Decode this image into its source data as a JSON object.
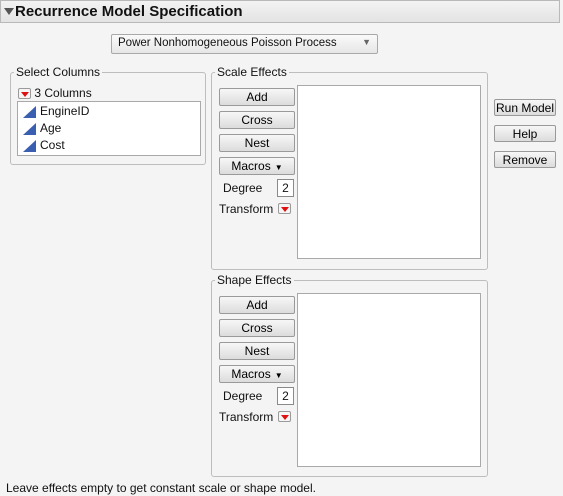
{
  "window": {
    "title": "Recurrence Model Specification"
  },
  "model_type": {
    "selected": "Power Nonhomogeneous Poisson Process"
  },
  "select_columns": {
    "legend": "Select Columns",
    "count_label": "3 Columns",
    "columns": [
      {
        "name": "EngineID",
        "icon": "continuous-column-icon"
      },
      {
        "name": "Age",
        "icon": "continuous-column-icon"
      },
      {
        "name": "Cost",
        "icon": "continuous-column-icon"
      }
    ]
  },
  "scale_effects": {
    "legend": "Scale Effects",
    "add": "Add",
    "cross": "Cross",
    "nest": "Nest",
    "macros": "Macros",
    "degree_label": "Degree",
    "degree_value": "2",
    "transform_label": "Transform"
  },
  "shape_effects": {
    "legend": "Shape Effects",
    "add": "Add",
    "cross": "Cross",
    "nest": "Nest",
    "macros": "Macros",
    "degree_label": "Degree",
    "degree_value": "2",
    "transform_label": "Transform"
  },
  "actions": {
    "run_model": "Run Model",
    "help": "Help",
    "remove": "Remove"
  },
  "footer": {
    "note": "Leave effects empty to get constant scale or shape model."
  },
  "colors": {
    "accent_red": "#d11111",
    "column_icon_blue": "#3b5fb0"
  }
}
